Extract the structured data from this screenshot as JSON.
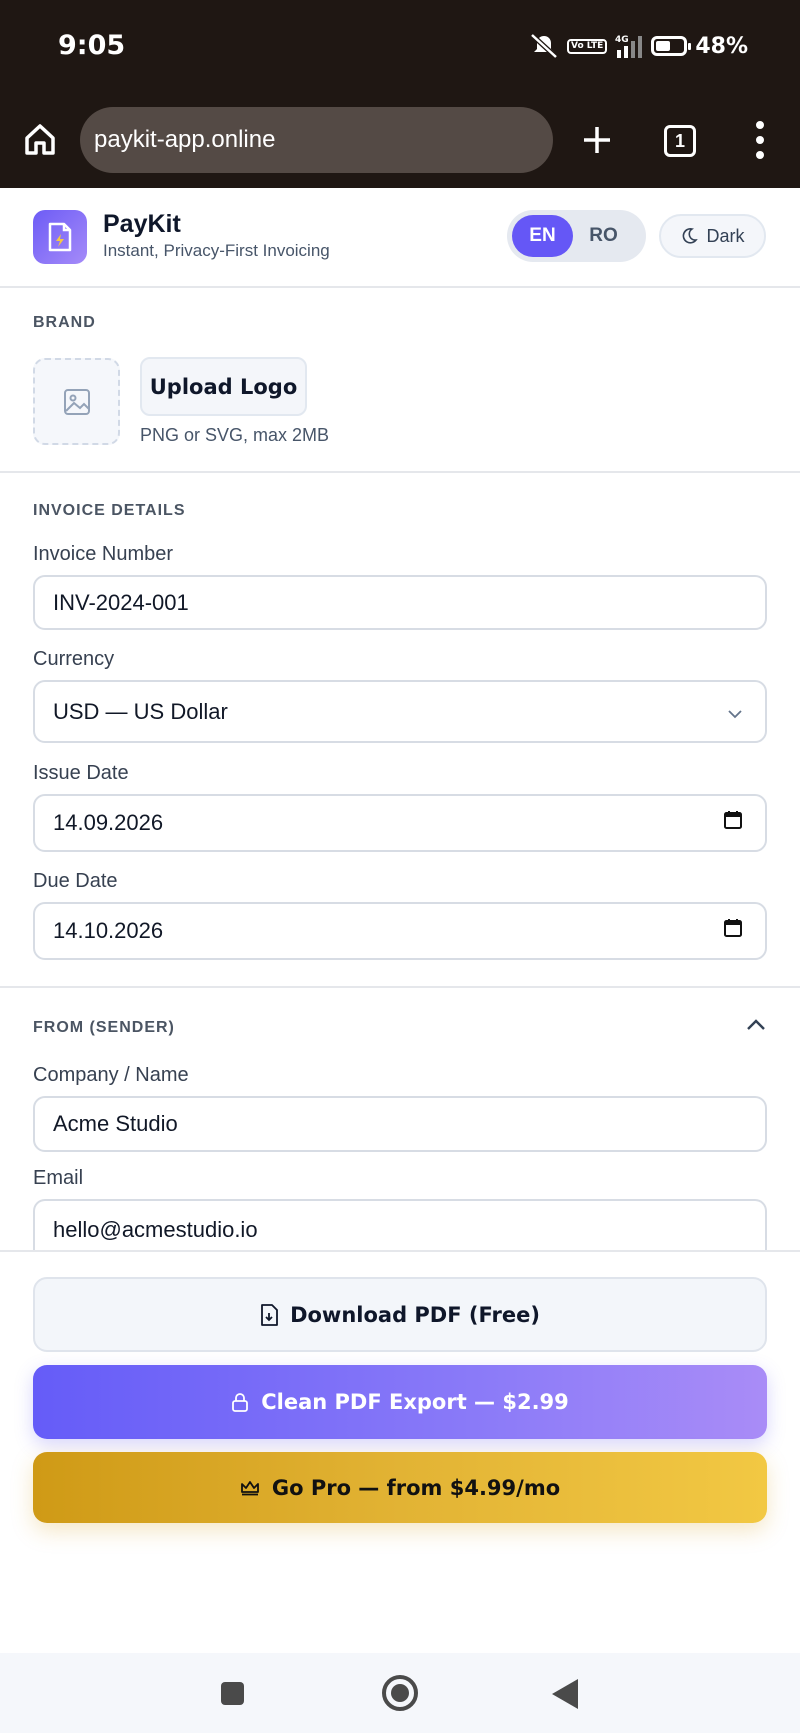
{
  "status_bar": {
    "time": "9:05",
    "battery": "48%",
    "network": "4G",
    "volte": "Vo LTE",
    "icons": [
      "mute-icon",
      "volte-icon",
      "signal-icon",
      "battery-icon"
    ]
  },
  "browser": {
    "url": "paykit-app.online",
    "tab_count": "1",
    "icons": [
      "home-icon",
      "plus-icon",
      "tabs-icon",
      "menu-icon"
    ]
  },
  "app": {
    "name": "PayKit",
    "tagline": "Instant, Privacy-First Invoicing",
    "languages": [
      "EN",
      "RO"
    ],
    "active_language": "EN",
    "theme_label": "Dark",
    "accent": "#6557f6"
  },
  "brand": {
    "section_title": "BRAND",
    "upload_label": "Upload Logo",
    "upload_hint": "PNG or SVG, max 2MB"
  },
  "invoice": {
    "section_title": "INVOICE DETAILS",
    "number_label": "Invoice Number",
    "number_value": "INV-2024-001",
    "currency_label": "Currency",
    "currency_value": "USD — US Dollar",
    "issue_label": "Issue Date",
    "issue_value": "14.09.2026",
    "due_label": "Due Date",
    "due_value": "14.10.2026"
  },
  "sender": {
    "section_title": "FROM (SENDER)",
    "company_label": "Company / Name",
    "company_value": "Acme Studio",
    "email_label": "Email",
    "email_value": "hello@acmestudio.io"
  },
  "actions": {
    "download_label": "Download PDF (Free)",
    "clean_label": "Clean PDF Export — $2.99",
    "pro_label": "Go Pro — from $4.99/mo"
  }
}
